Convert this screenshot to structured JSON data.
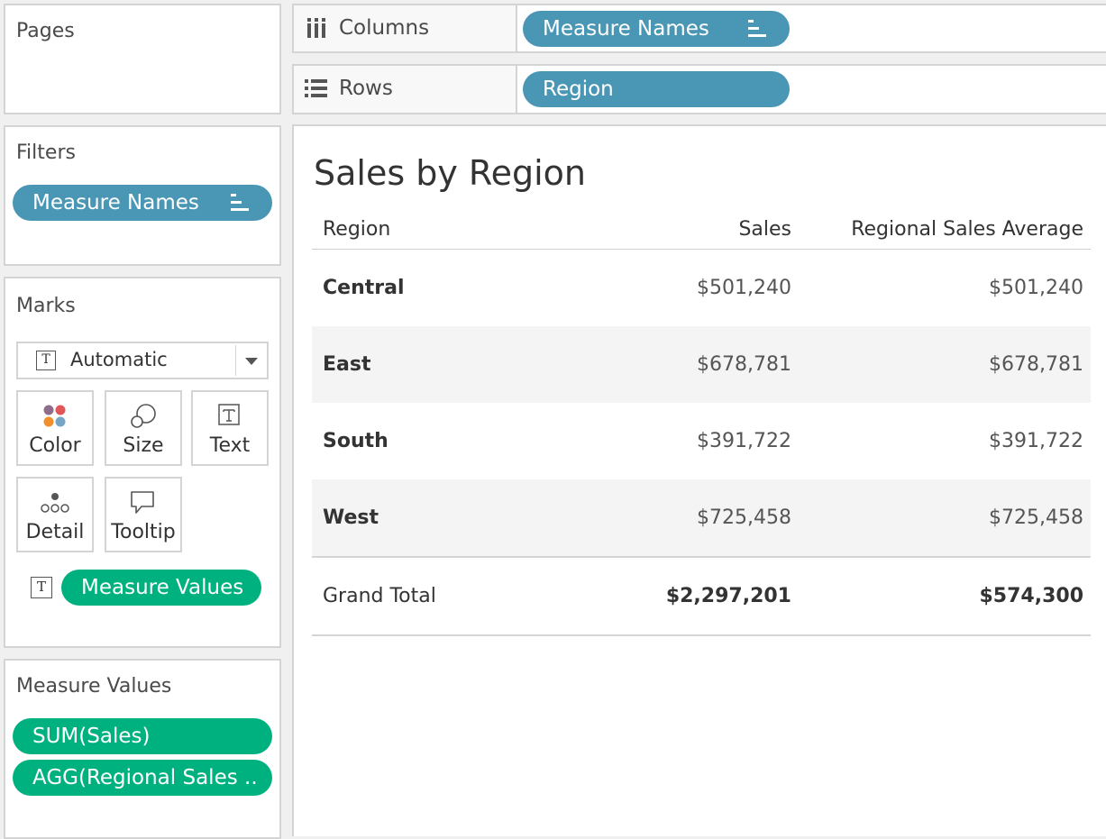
{
  "pages": {
    "title": "Pages"
  },
  "filters": {
    "title": "Filters",
    "pills": [
      "Measure Names"
    ]
  },
  "marks": {
    "title": "Marks",
    "type_select": "Automatic",
    "cards": [
      "Color",
      "Size",
      "Text",
      "Detail",
      "Tooltip"
    ],
    "text_pill": "Measure Values"
  },
  "measure_values": {
    "title": "Measure Values",
    "pills": [
      "SUM(Sales)",
      "AGG(Regional Sales .."
    ]
  },
  "columns": {
    "label": "Columns",
    "pill": "Measure Names"
  },
  "rows": {
    "label": "Rows",
    "pill": "Region"
  },
  "view": {
    "title": "Sales by Region",
    "headers": [
      "Region",
      "Sales",
      "Regional Sales Average"
    ],
    "rows": [
      {
        "region": "Central",
        "sales": "$501,240",
        "avg": "$501,240"
      },
      {
        "region": "East",
        "sales": "$678,781",
        "avg": "$678,781"
      },
      {
        "region": "South",
        "sales": "$391,722",
        "avg": "$391,722"
      },
      {
        "region": "West",
        "sales": "$725,458",
        "avg": "$725,458"
      }
    ],
    "total": {
      "region": "Grand Total",
      "sales": "$2,297,201",
      "avg": "$574,300"
    }
  },
  "colors": {
    "dimension_pill": "#4a96b5",
    "measure_pill": "#00b180"
  }
}
